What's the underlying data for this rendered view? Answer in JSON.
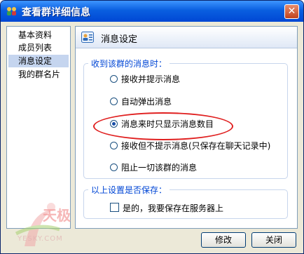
{
  "window": {
    "title": "查看群详细信息",
    "close_glyph": "✕"
  },
  "sidebar": {
    "items": [
      {
        "label": "基本资料",
        "active": false
      },
      {
        "label": "成员列表",
        "active": false
      },
      {
        "label": "消息设定",
        "active": true
      },
      {
        "label": "我的群名片",
        "active": false
      }
    ]
  },
  "panel": {
    "title": "消息设定",
    "receive_group": {
      "legend": "收到该群的消息时：",
      "options": [
        {
          "label": "接收并提示消息",
          "checked": false
        },
        {
          "label": "自动弹出消息",
          "checked": false
        },
        {
          "label": "消息来时只显示消息数目",
          "checked": true
        },
        {
          "label": "接收但不提示消息(只保存在聊天记录中)",
          "checked": false
        },
        {
          "label": "阻止一切该群的消息",
          "checked": false
        }
      ]
    },
    "save_group": {
      "legend": "以上设置是否保存：",
      "checkbox_label": "是的，我要保存在服务器上",
      "checked": false
    }
  },
  "buttons": {
    "modify": "修改",
    "close": "关闭"
  },
  "watermark": {
    "text": "天极",
    "url": "YESKY.COM"
  },
  "colors": {
    "titlebar": "#0a5fe0",
    "legend": "#0046d5",
    "highlight": "#e02020",
    "nav_active": "#c5d5ef"
  }
}
